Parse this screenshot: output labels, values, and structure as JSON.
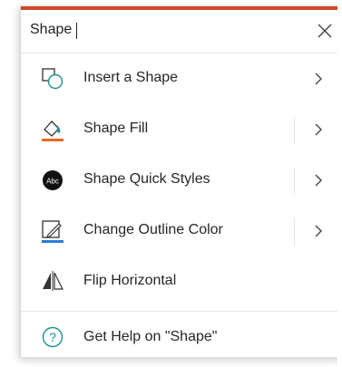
{
  "search": {
    "value": "Shape",
    "placeholder": ""
  },
  "items": [
    {
      "label": "Insert a Shape",
      "icon": "insert-shape-icon",
      "has_split": false,
      "has_chevron": true
    },
    {
      "label": "Shape Fill",
      "icon": "shape-fill-icon",
      "has_split": true,
      "has_chevron": true
    },
    {
      "label": "Shape Quick Styles",
      "icon": "shape-quick-styles-icon",
      "icon_text": "Abc",
      "has_split": true,
      "has_chevron": true
    },
    {
      "label": "Change Outline Color",
      "icon": "change-outline-color-icon",
      "has_split": true,
      "has_chevron": true
    },
    {
      "label": "Flip Horizontal",
      "icon": "flip-horizontal-icon",
      "has_split": false,
      "has_chevron": false
    }
  ],
  "help": {
    "label": "Get Help on \"Shape\"",
    "icon": "help-icon"
  },
  "colors": {
    "accent": "#d24726",
    "fill_orange": "#e86a1e",
    "teal": "#1e8f8f",
    "outline_blue": "#2b7cd3"
  }
}
